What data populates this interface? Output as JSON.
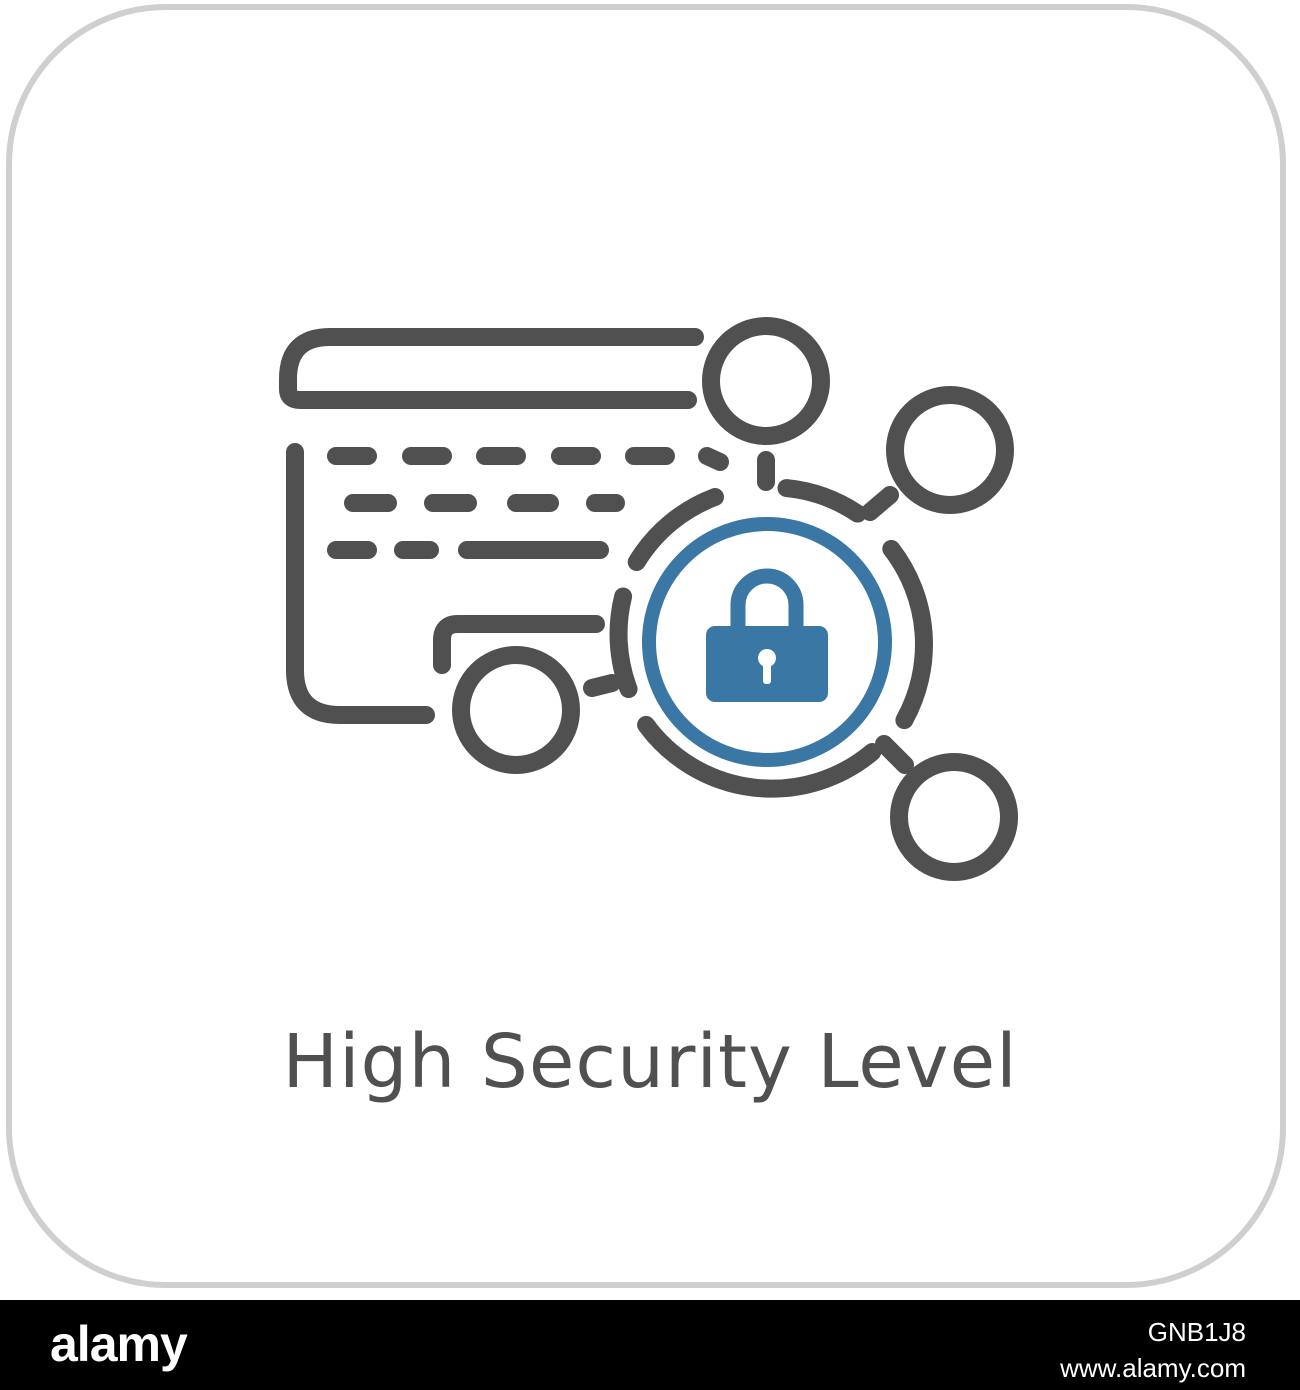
{
  "caption": "High Security Level",
  "icon": {
    "name": "secure-keyboard-network-lock",
    "stroke_color": "#505050",
    "accent_color": "#3a77a5"
  },
  "footer": {
    "brand": "alamy",
    "stock_id": "GNB1J8",
    "site": "www.alamy.com"
  },
  "colors": {
    "tile_border": "#cfcfcf",
    "caption": "#505050",
    "footer_bg": "#000000"
  }
}
